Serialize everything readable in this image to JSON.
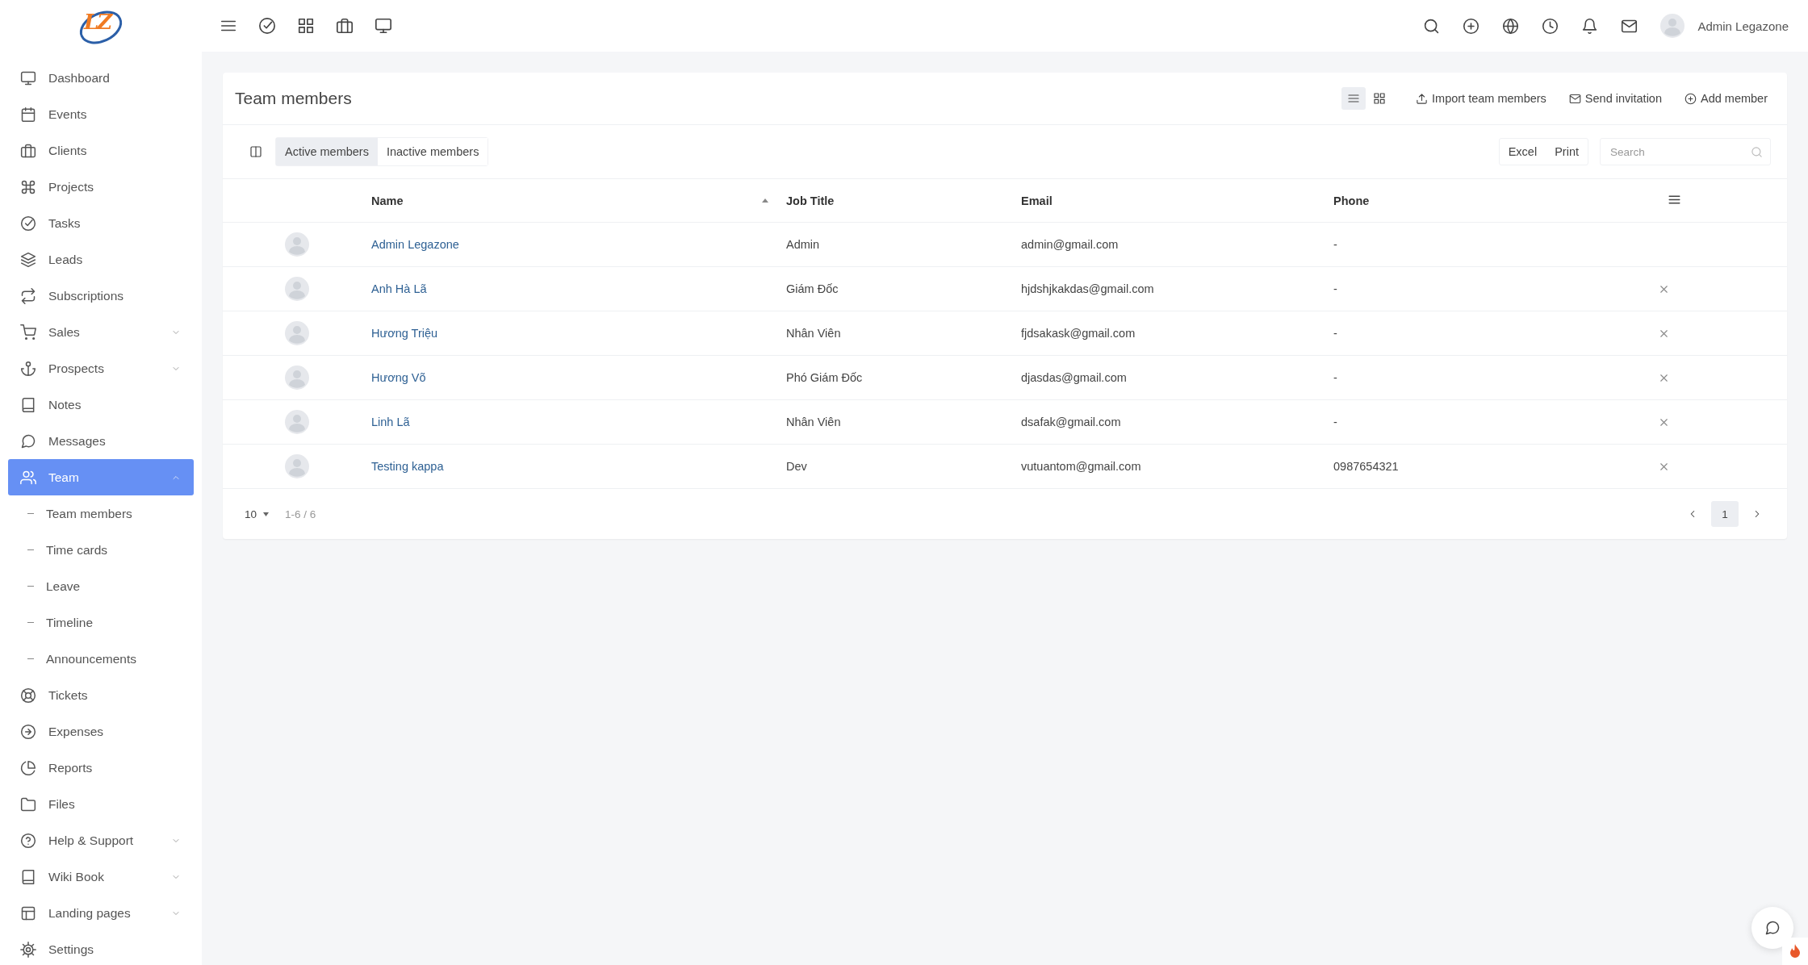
{
  "logo": {
    "text": "LZ"
  },
  "topbar": {
    "user_name": "Admin Legazone"
  },
  "sidebar": {
    "items": [
      {
        "label": "Dashboard",
        "selected": false
      },
      {
        "label": "Events",
        "selected": false
      },
      {
        "label": "Clients",
        "selected": false
      },
      {
        "label": "Projects",
        "selected": false
      },
      {
        "label": "Tasks",
        "selected": false
      },
      {
        "label": "Leads",
        "selected": false
      },
      {
        "label": "Subscriptions",
        "selected": false
      },
      {
        "label": "Sales",
        "selected": false,
        "expanded": false
      },
      {
        "label": "Prospects",
        "selected": false,
        "expanded": false
      },
      {
        "label": "Notes",
        "selected": false
      },
      {
        "label": "Messages",
        "selected": false
      },
      {
        "label": "Team",
        "selected": true,
        "expanded": true,
        "children": [
          {
            "label": "Team members",
            "selected": false
          },
          {
            "label": "Time cards",
            "selected": false
          },
          {
            "label": "Leave",
            "selected": false
          },
          {
            "label": "Timeline",
            "selected": false
          },
          {
            "label": "Announcements",
            "selected": false
          }
        ]
      },
      {
        "label": "Tickets",
        "selected": false
      },
      {
        "label": "Expenses",
        "selected": false
      },
      {
        "label": "Reports",
        "selected": false
      },
      {
        "label": "Files",
        "selected": false
      },
      {
        "label": "Help & Support",
        "selected": false,
        "expanded": false
      },
      {
        "label": "Wiki Book",
        "selected": false,
        "expanded": false
      },
      {
        "label": "Landing pages",
        "selected": false,
        "expanded": false
      },
      {
        "label": "Settings",
        "selected": false
      }
    ]
  },
  "card": {
    "title": "Team members",
    "view_toggles": [
      {
        "selected": true
      },
      {
        "selected": false
      }
    ],
    "actions": [
      "Import team members",
      "Send invitation",
      "Add member"
    ],
    "tabs": [
      {
        "label": "Active members",
        "selected": true
      },
      {
        "label": "Inactive members",
        "selected": false
      }
    ],
    "export_buttons": [
      "Excel",
      "Print"
    ],
    "search": {
      "placeholder": "Search"
    },
    "table": {
      "columns": [
        {
          "label": "Name",
          "sorted": true
        },
        {
          "label": "Job Title",
          "sorted": false
        },
        {
          "label": "Email",
          "sorted": false
        },
        {
          "label": "Phone",
          "sorted": false
        }
      ],
      "rows": [
        {
          "name": "Admin Legazone",
          "job_title": "Admin",
          "email": "admin@gmail.com",
          "phone": "-",
          "removable": false
        },
        {
          "name": "Anh Hà Lã",
          "job_title": "Giám Đốc",
          "email": "hjdshjkakdas@gmail.com",
          "phone": "-",
          "removable": true
        },
        {
          "name": "Hương Triệu",
          "job_title": "Nhân Viên",
          "email": "fjdsakask@gmail.com",
          "phone": "-",
          "removable": true
        },
        {
          "name": "Hương Võ",
          "job_title": "Phó Giám Đốc",
          "email": "djasdas@gmail.com",
          "phone": "-",
          "removable": true
        },
        {
          "name": "Linh Lã",
          "job_title": "Nhân Viên",
          "email": "dsafak@gmail.com",
          "phone": "-",
          "removable": true
        },
        {
          "name": "Testing kappa",
          "job_title": "Dev",
          "email": "vutuantom@gmail.com",
          "phone": "0987654321",
          "removable": true
        }
      ]
    },
    "footer": {
      "page_size": "10",
      "range": "1-6 / 6",
      "pages": [
        {
          "label": "1",
          "selected": true
        }
      ]
    }
  }
}
